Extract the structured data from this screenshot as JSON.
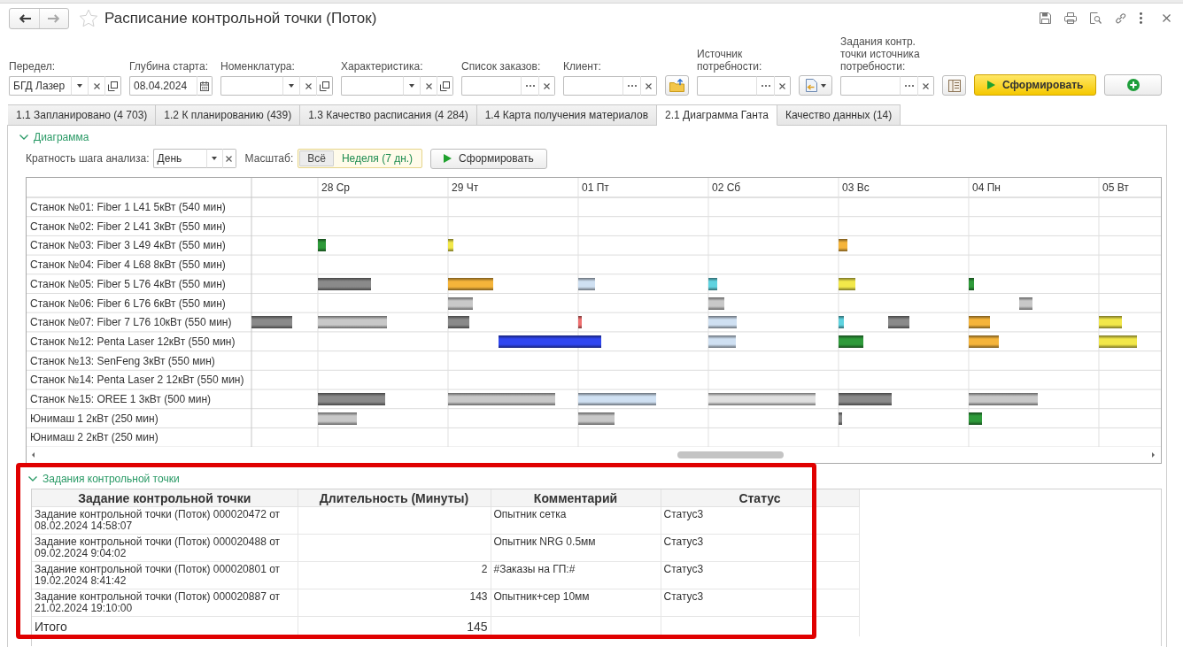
{
  "window": {
    "title": "Расписание контрольной точки (Поток)",
    "favorite": false
  },
  "toolbar": [
    {
      "kind": "select",
      "label": "Передел:",
      "value": "БГД Лазер"
    },
    {
      "kind": "date",
      "label": "Глубина старта:",
      "value": "08.04.2024"
    },
    {
      "kind": "select",
      "label": "Номенклатура:"
    },
    {
      "kind": "select",
      "label": "Характеристика:"
    },
    {
      "kind": "picker",
      "label": "Список заказов:"
    },
    {
      "kind": "picker",
      "label": "Клиент:"
    },
    {
      "kind": "folder_button"
    },
    {
      "kind": "picker",
      "label": "Источник потребности:"
    },
    {
      "kind": "document_menu_button"
    },
    {
      "kind": "picker",
      "label": "Задания контр. точки источника потребности:"
    },
    {
      "kind": "panel_button"
    },
    {
      "kind": "primary_button",
      "label": "Сформировать"
    },
    {
      "kind": "add_button"
    }
  ],
  "tabs": [
    {
      "label": "1.1 Запланировано (4 703)",
      "selected": false
    },
    {
      "label": "1.2 К планированию (439)",
      "selected": false
    },
    {
      "label": "1.3 Качество расписания (4 284)",
      "selected": false
    },
    {
      "label": "1.4 Карта получения материалов",
      "selected": false
    },
    {
      "label": "2.1 Диаграмма Ганта",
      "selected": true
    },
    {
      "label": "Качество данных (14)",
      "selected": false
    }
  ],
  "diagram": {
    "title": "Диаграмма",
    "expanded": true,
    "step": {
      "label": "Кратность шага анализа:",
      "value": "День"
    },
    "scale": {
      "label": "Масштаб:",
      "options": [
        {
          "label": "Всё",
          "selected": false
        },
        {
          "label": "Неделя (7 дн.)",
          "selected": true
        }
      ]
    },
    "button": "Сформировать",
    "gantt": {
      "days": [
        "28 Ср",
        "29 Чт",
        "01 Пт",
        "02 Сб",
        "03 Вс",
        "04 Пн",
        "05 Вт"
      ],
      "rows": [
        {
          "label": "Станок №01: Fiber 1 L41 5кВт (540 мин)"
        },
        {
          "label": "Станок №02: Fiber 2 L41 3кВт (550 мин)"
        },
        {
          "label": "Станок №03: Fiber 3 L49 4кВт (550 мин)",
          "bars": [
            {
              "color": "#2e9a3a"
            },
            {
              "color": "#f2e84a"
            },
            {
              "color": "#f5b43a"
            }
          ]
        },
        {
          "label": "Станок №04: Fiber 4 L68 8кВт (550 мин)"
        },
        {
          "label": "Станок №05: Fiber 5 L76 4кВт (550 мин)",
          "bars": [
            {
              "color": "#8a8a8a"
            },
            {
              "color": "#f5b43a"
            },
            {
              "color": "#cfe0f2"
            },
            {
              "color": "#5fd3e0"
            },
            {
              "color": "#f2e84a"
            },
            {
              "color": "#2e9a3a"
            }
          ]
        },
        {
          "label": "Станок №06: Fiber 6 L76 6кВт (550 мин)",
          "bars": [
            {
              "color": "#c8c8c8"
            },
            {
              "color": "#c8c8c8"
            },
            {
              "color": "#c8c8c8"
            }
          ]
        },
        {
          "label": "Станок №07: Fiber 7 L76 10кВт (550 мин)",
          "bars": [
            {
              "color": "#8a8a8a"
            },
            {
              "color": "#c8c8c8"
            },
            {
              "color": "#8a8a8a"
            },
            {
              "color": "#f07070"
            },
            {
              "color": "#cfe0f2"
            },
            {
              "color": "#5fd3e0"
            },
            {
              "color": "#8a8a8a"
            },
            {
              "color": "#f5b43a"
            },
            {
              "color": "#f2e84a"
            }
          ]
        },
        {
          "label": "Станок №12: Penta Laser 12кВт (550 мин)",
          "bars": [
            {
              "color": "#2f46f0"
            },
            {
              "color": "#cfe0f2"
            },
            {
              "color": "#2e9a3a"
            },
            {
              "color": "#f5b43a"
            },
            {
              "color": "#f2e84a"
            }
          ]
        },
        {
          "label": "Станок №13: SenFeng 3кВт (550 мин)"
        },
        {
          "label": "Станок №14: Penta Laser 2 12кВт (550 мин)"
        },
        {
          "label": "Станок №15: OREE 1 3кВт (500 мин)",
          "bars": [
            {
              "color": "#8a8a8a"
            },
            {
              "color": "#c8c8c8"
            },
            {
              "color": "#cfe0f2"
            },
            {
              "color": "#e0e0e0"
            },
            {
              "color": "#8a8a8a"
            },
            {
              "color": "#c8c8c8"
            }
          ]
        },
        {
          "label": "Юнимаш 1 2кВт (250 мин)",
          "bars": [
            {
              "color": "#c8c8c8"
            },
            {
              "color": "#c8c8c8"
            },
            {
              "color": "#8a8a8a"
            },
            {
              "color": "#2e9a3a"
            }
          ]
        },
        {
          "label": "Юнимаш 2 2кВт (250 мин)"
        }
      ]
    }
  },
  "tasks": {
    "title": "Задания контрольной точки",
    "expanded": true,
    "highlighted": true,
    "columns": [
      "Задание контрольной точки",
      "Длительность (Минуты)",
      "Комментарий",
      "Статус"
    ],
    "rows": [
      {
        "task": "Задание контрольной точки (Поток) 000020472 от 08.02.2024 14:58:07",
        "comment": "Опытник сетка",
        "status": "Статус3"
      },
      {
        "task": "Задание контрольной точки (Поток) 000020488 от 09.02.2024 9:04:02",
        "comment": "Опытник NRG 0.5мм",
        "status": "Статус3"
      },
      {
        "task": "Задание контрольной точки (Поток) 000020801 от 19.02.2024 8:41:42",
        "duration": "2",
        "comment": "#Заказы на ГП:#",
        "status": "Статус3"
      },
      {
        "task": "Задание контрольной точки (Поток) 000020887 от 21.02.2024 19:10:00",
        "duration": "143",
        "comment": "Опытник+сер 10мм",
        "status": "Статус3"
      }
    ],
    "total": {
      "label": "Итого",
      "duration": "145"
    }
  }
}
